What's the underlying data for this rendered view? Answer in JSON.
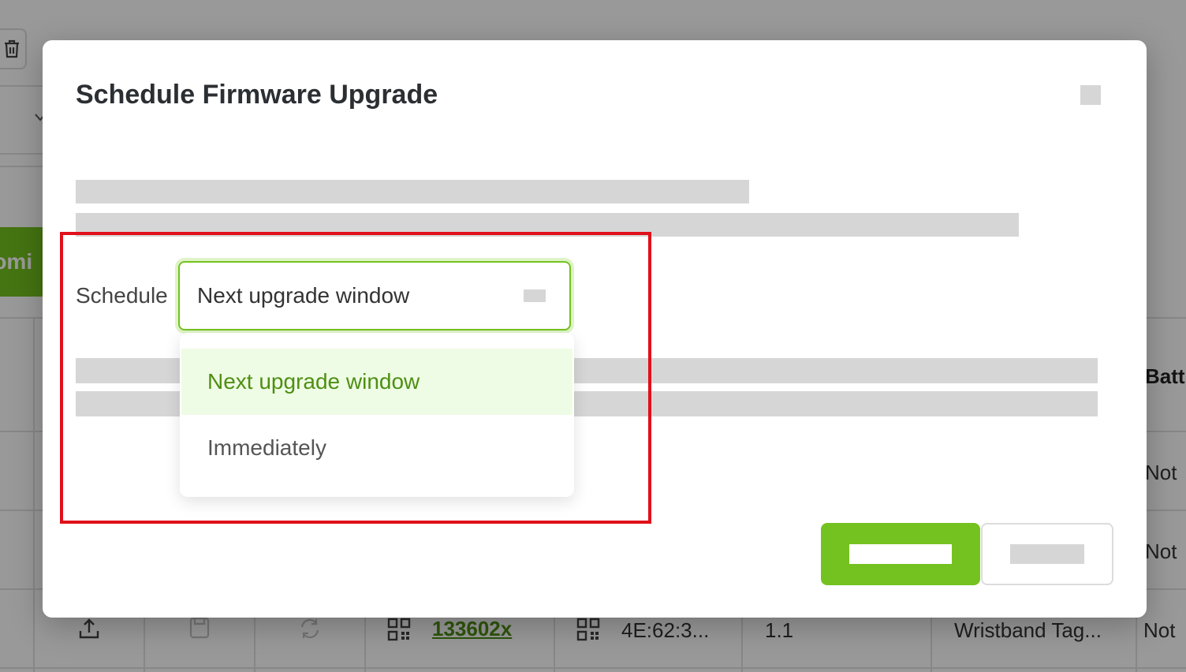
{
  "modal": {
    "title": "Schedule Firmware Upgrade",
    "schedule_label": "Schedule",
    "select_value": "Next upgrade window",
    "options": [
      {
        "label": "Next upgrade window",
        "selected": true
      },
      {
        "label": "Immediately",
        "selected": false
      }
    ]
  },
  "background": {
    "button_fragment": "tomi",
    "column_header_fragment": "Batt",
    "row_status": [
      "Not",
      "Not",
      "Not"
    ],
    "last_row": {
      "id_link": "133602x",
      "mac": "4E:62:3...",
      "version": "1.1",
      "type": "Wristband Tag..."
    }
  },
  "colors": {
    "accent": "#74c21f",
    "highlight": "#e0101a",
    "selected_option_bg": "#effce5",
    "selected_option_text": "#4e8f12"
  },
  "icons": [
    "trash-icon",
    "chevron-down-icon",
    "upload-icon",
    "save-icon",
    "sync-icon",
    "qr-code-icon"
  ]
}
